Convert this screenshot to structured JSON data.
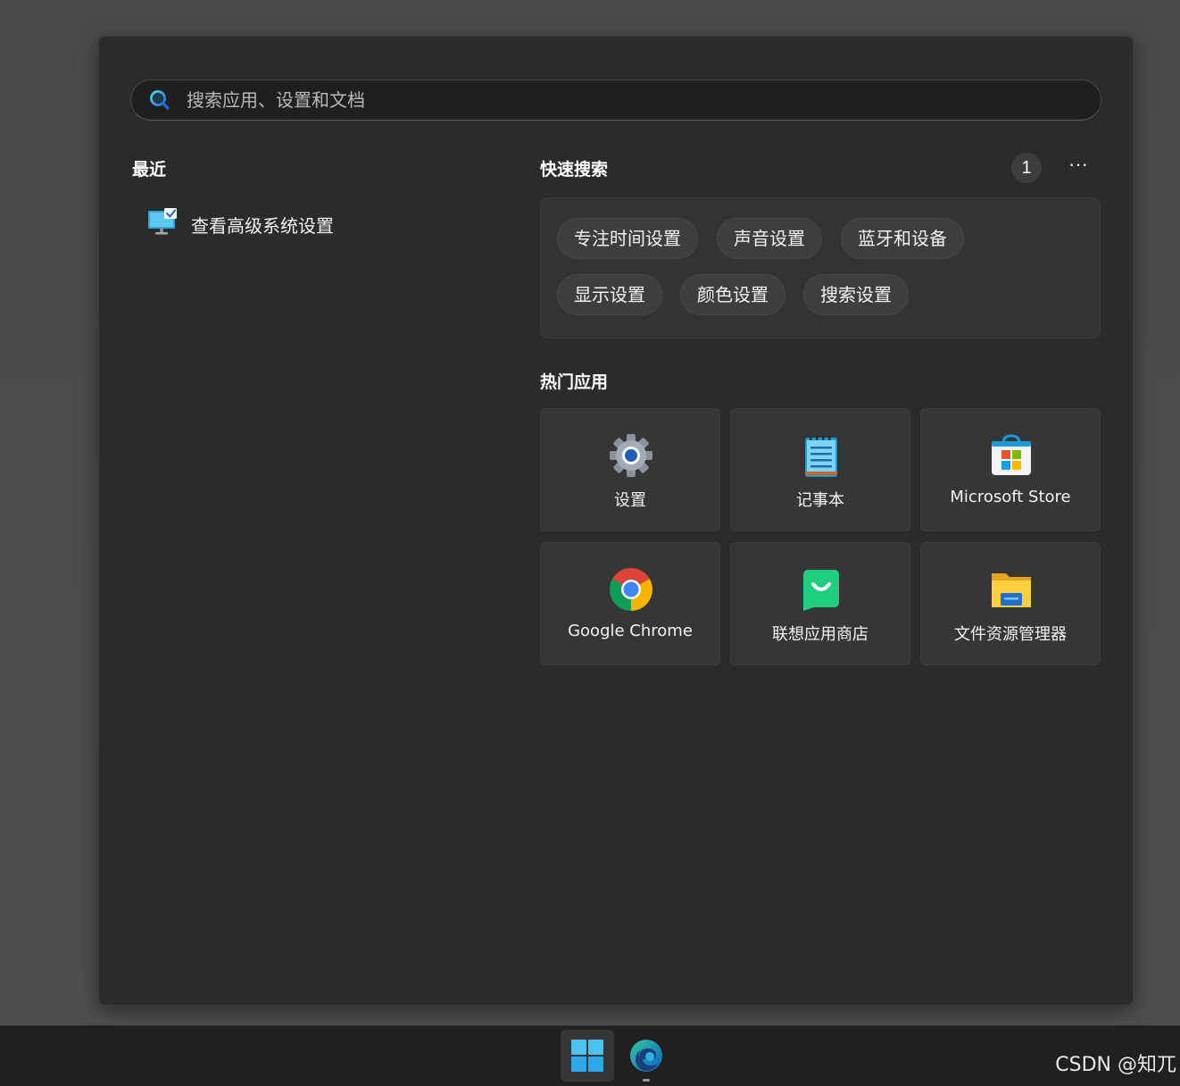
{
  "search": {
    "placeholder": "搜索应用、设置和文档",
    "value": ""
  },
  "recent": {
    "title": "最近",
    "items": [
      {
        "label": "查看高级系统设置",
        "icon": "monitor-check-icon"
      }
    ]
  },
  "quick_search": {
    "title": "快速搜索",
    "count": "1",
    "more": "···",
    "chips": [
      {
        "label": "专注时间设置"
      },
      {
        "label": "声音设置"
      },
      {
        "label": "蓝牙和设备"
      },
      {
        "label": "显示设置"
      },
      {
        "label": "颜色设置"
      },
      {
        "label": "搜索设置"
      }
    ]
  },
  "hot_apps": {
    "title": "热门应用",
    "apps": [
      {
        "label": "设置",
        "icon": "settings-gear-icon"
      },
      {
        "label": "记事本",
        "icon": "notepad-icon"
      },
      {
        "label": "Microsoft Store",
        "icon": "microsoft-store-icon"
      },
      {
        "label": "Google Chrome",
        "icon": "chrome-icon"
      },
      {
        "label": "联想应用商店",
        "icon": "lenovo-app-store-icon"
      },
      {
        "label": "文件资源管理器",
        "icon": "file-explorer-icon"
      }
    ]
  },
  "taskbar": {
    "items": [
      {
        "icon": "windows-start-icon"
      },
      {
        "icon": "edge-icon"
      }
    ]
  },
  "watermark": "CSDN @知兀",
  "colors": {
    "panel_bg": "#2b2b2b",
    "card_bg": "#333333",
    "chip_bg": "#3e3e3e",
    "tile_bg": "#363636",
    "taskbar_bg": "#202020",
    "accent": "#0078d4"
  }
}
